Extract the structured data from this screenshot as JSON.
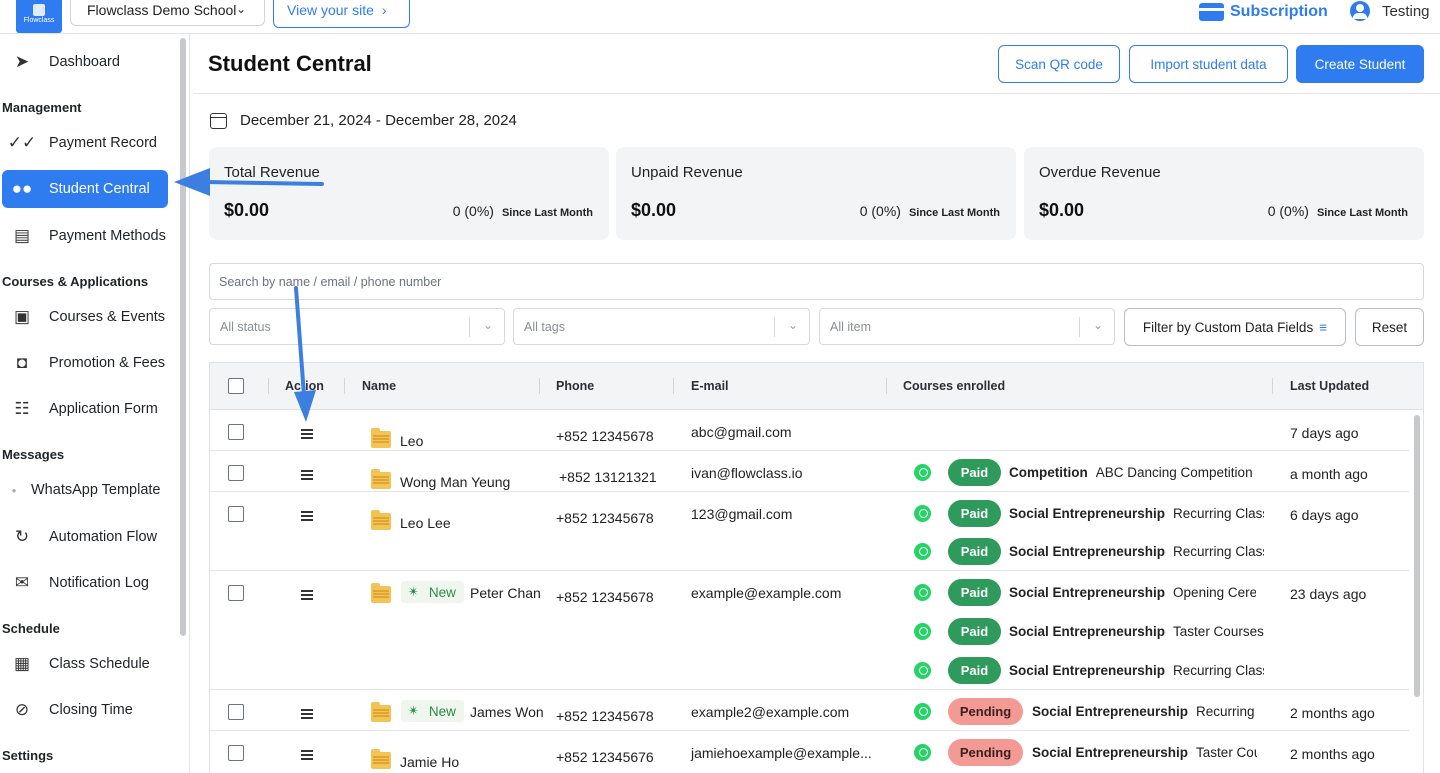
{
  "topbar": {
    "logo_text": "Flowclass",
    "school_name": "Flowclass Demo School",
    "view_site": "View your site",
    "subscription": "Subscription",
    "user_name": "Testing"
  },
  "sidebar": {
    "dashboard": "Dashboard",
    "sec_management": "Management",
    "payment_record": "Payment Record",
    "student_central": "Student Central",
    "payment_methods": "Payment Methods",
    "sec_courses": "Courses & Applications",
    "courses_events": "Courses & Events",
    "promotion_fees": "Promotion & Fees",
    "application_form": "Application Form",
    "sec_messages": "Messages",
    "whatsapp_template": "WhatsApp Template",
    "automation_flow": "Automation Flow",
    "notification_log": "Notification Log",
    "sec_schedule": "Schedule",
    "class_schedule": "Class Schedule",
    "closing_time": "Closing Time",
    "sec_settings": "Settings"
  },
  "header": {
    "title": "Student Central",
    "scan_qr": "Scan QR code",
    "import": "Import student data",
    "create": "Create Student"
  },
  "date_range": "December 21, 2024 - December 28, 2024",
  "stats": [
    {
      "label": "Total Revenue",
      "amount": "$0.00",
      "change": "0 (0%)",
      "since": "Since Last Month"
    },
    {
      "label": "Unpaid Revenue",
      "amount": "$0.00",
      "change": "0 (0%)",
      "since": "Since Last Month"
    },
    {
      "label": "Overdue Revenue",
      "amount": "$0.00",
      "change": "0 (0%)",
      "since": "Since Last Month"
    }
  ],
  "filters": {
    "search_placeholder": "Search by name / email / phone number",
    "status": "All status",
    "tags": "All tags",
    "item": "All item",
    "custom_fields": "Filter by Custom Data Fields",
    "reset": "Reset"
  },
  "table": {
    "headers": {
      "action": "Action",
      "name": "Name",
      "phone": "Phone",
      "email": "E-mail",
      "courses": "Courses enrolled",
      "updated": "Last Updated"
    },
    "new_label": "New",
    "rows": [
      {
        "name": "Leo",
        "phone": "+852 12345678",
        "email": "abc@gmail.com",
        "updated": "7 days ago",
        "courses": []
      },
      {
        "name": "Wong Man Yeung",
        "phone": "+852 13121321",
        "email": "ivan@flowclass.io",
        "updated": "a month ago",
        "courses": [
          {
            "status": "Paid",
            "category": "Competition",
            "course": "ABC Dancing Competition"
          }
        ]
      },
      {
        "name": "Leo Lee",
        "phone": "+852 12345678",
        "email": "123@gmail.com",
        "updated": "6 days ago",
        "courses": [
          {
            "status": "Paid",
            "category": "Social Entrepreneurship",
            "course": "Recurring Class"
          },
          {
            "status": "Paid",
            "category": "Social Entrepreneurship",
            "course": "Recurring Class"
          }
        ]
      },
      {
        "name": "Peter Chan",
        "phone": "+852 12345678",
        "email": "example@example.com",
        "updated": "23 days ago",
        "courses": [
          {
            "status": "Paid",
            "category": "Social Entrepreneurship",
            "course": "Opening Ceremony"
          },
          {
            "status": "Paid",
            "category": "Social Entrepreneurship",
            "course": "Taster Courses"
          },
          {
            "status": "Paid",
            "category": "Social Entrepreneurship",
            "course": "Recurring Class"
          }
        ]
      },
      {
        "name": "James Won",
        "phone": "+852 12345678",
        "email": "example2@example.com",
        "updated": "2 months ago",
        "courses": [
          {
            "status": "Pending",
            "category": "Social Entrepreneurship",
            "course": "Recurring Class"
          }
        ]
      },
      {
        "name": "Jamie Ho",
        "phone": "+852 12345676",
        "email": "jamiehoexample@example...",
        "updated": "2 months ago",
        "courses": [
          {
            "status": "Pending",
            "category": "Social Entrepreneurship",
            "course": "Taster Courses"
          }
        ]
      }
    ]
  },
  "colors": {
    "accent": "#2f7cf0",
    "paid": "#2e9a5b",
    "pending": "#f39a95",
    "new": "#2e8a45"
  }
}
